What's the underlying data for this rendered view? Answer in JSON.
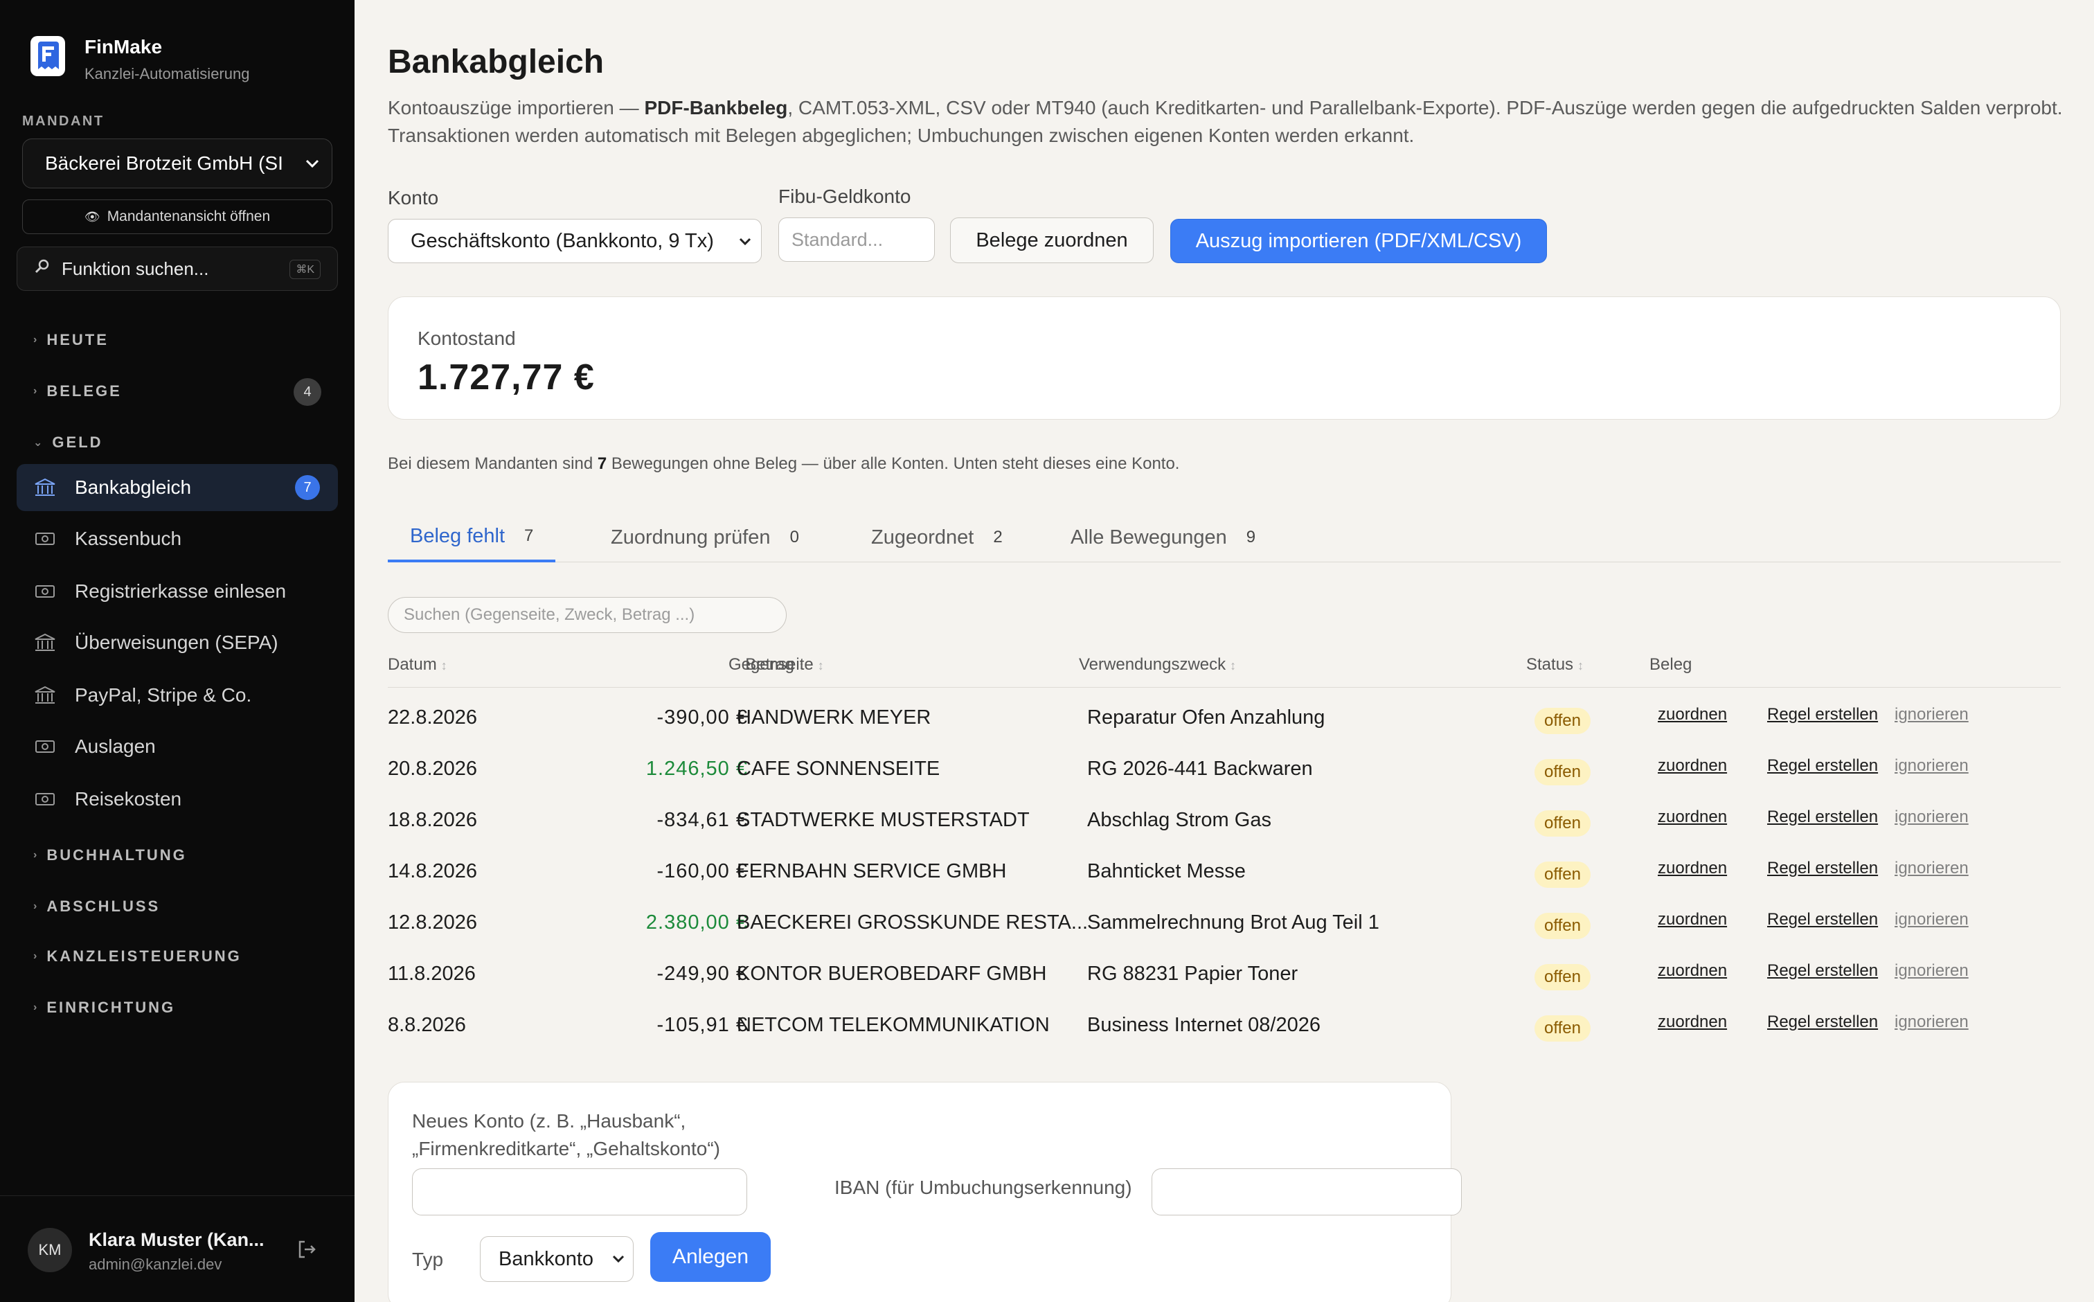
{
  "app": {
    "name": "FinMake",
    "subtitle": "Kanzlei-Automatisierung"
  },
  "sidebar": {
    "mandant_label": "MANDANT",
    "mandant_value": "Bäckerei Brotzeit GmbH (SI",
    "open_view": "Mandantenansicht öffnen",
    "search_placeholder": "Funktion suchen...",
    "search_shortcut": "⌘K",
    "sections": [
      {
        "label": "HEUTE",
        "caret": "›"
      },
      {
        "label": "BELEGE",
        "caret": "›",
        "count": "4"
      },
      {
        "label": "GELD",
        "caret": "⌄"
      },
      {
        "label": "BUCHHALTUNG",
        "caret": "›"
      },
      {
        "label": "ABSCHLUSS",
        "caret": "›"
      },
      {
        "label": "KANZLEISTEUERUNG",
        "caret": "›"
      },
      {
        "label": "EINRICHTUNG",
        "caret": "›"
      }
    ],
    "items": [
      {
        "label": "Bankabgleich",
        "icon": "bank-icon",
        "badge": "7",
        "active": true
      },
      {
        "label": "Kassenbuch",
        "icon": "cash-icon"
      },
      {
        "label": "Registrierkasse einlesen",
        "icon": "cash-icon"
      },
      {
        "label": "Überweisungen (SEPA)",
        "icon": "bank-icon"
      },
      {
        "label": "PayPal, Stripe & Co.",
        "icon": "bank-icon"
      },
      {
        "label": "Auslagen",
        "icon": "cash-icon"
      },
      {
        "label": "Reisekosten",
        "icon": "cash-icon"
      }
    ],
    "user": {
      "initials": "KM",
      "name": "Klara Muster (Kan...",
      "email": "admin@kanzlei.dev"
    }
  },
  "main": {
    "title": "Bankabgleich",
    "desc_pre": "Kontoauszüge importieren — ",
    "desc_bold": "PDF-Bankbeleg",
    "desc_post": ", CAMT.053-XML, CSV oder MT940 (auch Kreditkarten- und Parallelbank-Exporte). PDF-Auszüge werden gegen die aufgedruckten Salden verprobt. Transaktionen werden automatisch mit Belegen abgeglichen; Umbuchungen zwischen eigenen Konten werden erkannt.",
    "konto_label": "Konto",
    "konto_value": "Geschäftskonto (Bankkonto, 9 Tx)",
    "fibu_label": "Fibu-Geldkonto",
    "fibu_placeholder": "Standard...",
    "btn_assign": "Belege zuordnen",
    "btn_import": "Auszug importieren (PDF/XML/CSV)",
    "balance_label": "Kontostand",
    "balance_value": "1.727,77 €",
    "notice_pre": "Bei diesem Mandanten sind ",
    "notice_count": "7",
    "notice_post": " Bewegungen ohne Beleg — über alle Konten. Unten steht dieses eine Konto.",
    "tabs": [
      {
        "label": "Beleg fehlt",
        "count": "7",
        "active": true
      },
      {
        "label": "Zuordnung prüfen",
        "count": "0"
      },
      {
        "label": "Zugeordnet",
        "count": "2"
      },
      {
        "label": "Alle Bewegungen",
        "count": "9"
      }
    ],
    "search_placeholder": "Suchen (Gegenseite, Zweck, Betrag ...)",
    "columns": {
      "date": "Datum",
      "amount": "Betrag",
      "counterparty": "Gegenseite",
      "purpose": "Verwendungszweck",
      "status": "Status",
      "receipt": "Beleg"
    },
    "rows": [
      {
        "date": "22.8.2026",
        "amount": "-390,00 €",
        "positive": false,
        "counterparty": "HANDWERK MEYER",
        "purpose": "Reparatur Ofen Anzahlung",
        "status": "offen"
      },
      {
        "date": "20.8.2026",
        "amount": "1.246,50 €",
        "positive": true,
        "counterparty": "CAFE SONNENSEITE",
        "purpose": "RG 2026-441 Backwaren",
        "status": "offen"
      },
      {
        "date": "18.8.2026",
        "amount": "-834,61 €",
        "positive": false,
        "counterparty": "STADTWERKE MUSTERSTADT",
        "purpose": "Abschlag Strom Gas",
        "status": "offen"
      },
      {
        "date": "14.8.2026",
        "amount": "-160,00 €",
        "positive": false,
        "counterparty": "FERNBAHN SERVICE GMBH",
        "purpose": "Bahnticket Messe",
        "status": "offen"
      },
      {
        "date": "12.8.2026",
        "amount": "2.380,00 €",
        "positive": true,
        "counterparty": "BAECKEREI GROSSKUNDE RESTA...",
        "purpose": "Sammelrechnung Brot Aug Teil 1",
        "status": "offen"
      },
      {
        "date": "11.8.2026",
        "amount": "-249,90 €",
        "positive": false,
        "counterparty": "KONTOR BUEROBEDARF GMBH",
        "purpose": "RG 88231 Papier Toner",
        "status": "offen"
      },
      {
        "date": "8.8.2026",
        "amount": "-105,91 €",
        "positive": false,
        "counterparty": "NETCOM TELEKOMMUNIKATION",
        "purpose": "Business Internet 08/2026",
        "status": "offen"
      }
    ],
    "actions": {
      "assign": "zuordnen",
      "rule": "Regel erstellen",
      "ignore": "ignorieren"
    },
    "new_account": {
      "label": "Neues Konto (z. B. „Hausbank“, „Firmenkreditkarte“, „Gehaltskonto“)",
      "iban_label": "IBAN (für Umbuchungserkennung)",
      "type_label": "Typ",
      "type_value": "Bankkonto",
      "create": "Anlegen"
    }
  },
  "colors": {
    "accent": "#3b7cf5",
    "positive": "#1c8a3a",
    "badge_bg": "#fdf2c2",
    "sidebar_bg": "#0b0b0b"
  }
}
